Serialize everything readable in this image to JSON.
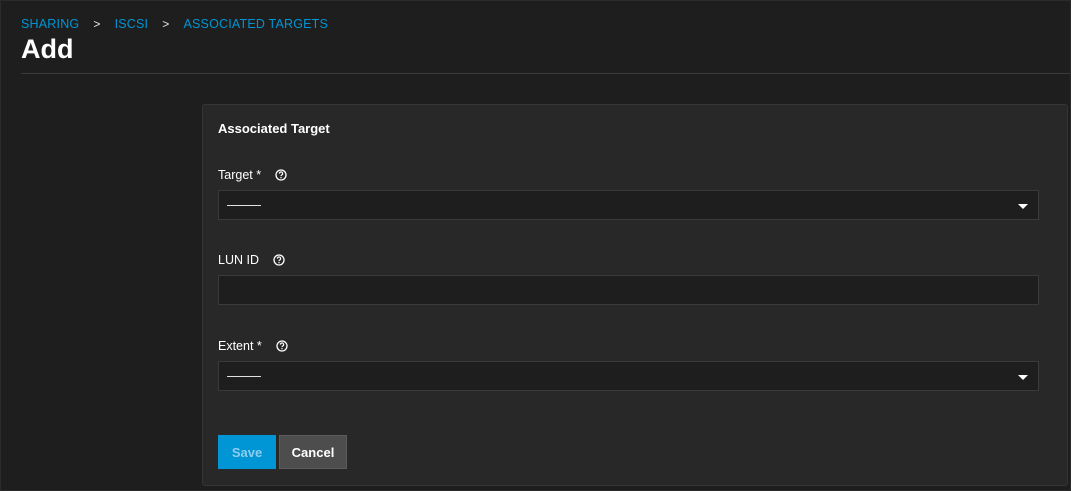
{
  "breadcrumb": {
    "items": [
      "SHARING",
      "ISCSI",
      "ASSOCIATED TARGETS"
    ],
    "separator": ">"
  },
  "page": {
    "title": "Add"
  },
  "form": {
    "title": "Associated Target",
    "target": {
      "label": "Target *",
      "value": "",
      "icon": "help-circle-icon"
    },
    "lun_id": {
      "label": "LUN ID",
      "value": "",
      "placeholder": "",
      "icon": "help-circle-icon"
    },
    "extent": {
      "label": "Extent *",
      "value": "",
      "icon": "help-circle-icon"
    }
  },
  "actions": {
    "save_label": "Save",
    "cancel_label": "Cancel"
  },
  "colors": {
    "accent": "#0095d5",
    "background": "#1e1e1e",
    "card": "#282828",
    "cancel_button": "#4d4d4d"
  }
}
